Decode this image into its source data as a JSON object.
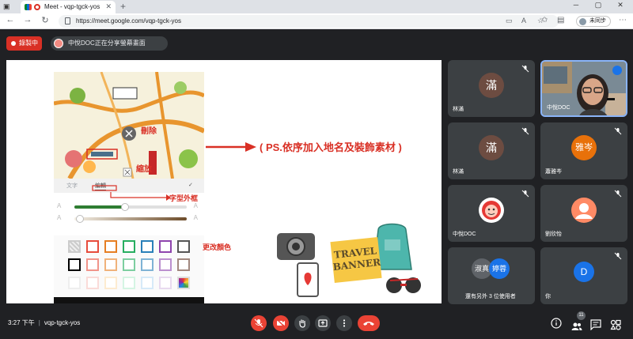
{
  "browser": {
    "tab_title": "Meet - vqp-tgck-yos",
    "tab_close": "✕",
    "new_tab": "+",
    "url": "https://meet.google.com/vqp-tgck-yos",
    "sync_label": "未同步",
    "window_minimize": "─",
    "window_maximize": "▢",
    "window_close": "✕"
  },
  "meet_top": {
    "recording_label": "錄製中",
    "presenter_text": "中悅DOC正在分享螢幕畫面"
  },
  "shared_screen": {
    "annotations": {
      "delete": "刪除",
      "scale": "縮放",
      "font_frame": "字型外框",
      "change_color": "更改顏色",
      "ps_note": "( PS.依序加入地名及裝飾素材 )"
    },
    "edit_tabs": [
      "文字",
      "編輯"
    ],
    "slider_levels": {
      "green": 0.45,
      "brown": 0.05
    },
    "swatch_colors": [
      [
        "#cccccc",
        "#e74c3c",
        "#e67e22",
        "#27ae60",
        "#2980b9",
        "#8e44ad",
        "#555555"
      ],
      [
        "#000000",
        "#f1948a",
        "#f0b27a",
        "#7dcea0",
        "#7fb3d5",
        "#bb8fce",
        "#a1887f"
      ],
      [
        "#eeeeee",
        "#fadbd8",
        "#fdebd0",
        "#d5f5e3",
        "#d6eaf8",
        "#e8daef",
        "#rainbow"
      ]
    ],
    "travel_banner": "TRAVEL BANNER"
  },
  "participants": [
    {
      "name": "林滿",
      "initial": "滿",
      "avatar_color": "#6d4c41",
      "muted": true
    },
    {
      "name": "中悅DOC",
      "initial": "",
      "avatar_color": "",
      "muted": false,
      "camera": true
    },
    {
      "name": "林滿",
      "initial": "滿",
      "avatar_color": "#6d4c41",
      "muted": true
    },
    {
      "name": "蕭雅岑",
      "initial": "雅岑",
      "avatar_color": "#e8710a",
      "muted": true
    },
    {
      "name": "中悅DOC",
      "initial": "",
      "avatar_color": "#ffffff",
      "muted": true
    },
    {
      "name": "劉欣怡",
      "initial": "",
      "avatar_color": "#ff8a65",
      "muted": true
    },
    {
      "name": "還有另外 3 位使用者",
      "initial": "淑真",
      "initial2": "婷蓉",
      "avatar_color": "#5f6368",
      "avatar_color2": "#1a73e8",
      "muted": false
    },
    {
      "name": "你",
      "initial": "D",
      "avatar_color": "#1a73e8",
      "muted": true
    }
  ],
  "bottom": {
    "time": "3:27 下午",
    "separator": "|",
    "meeting_code": "vqp-tgck-yos",
    "people_count": "11"
  },
  "colors": {
    "accent_red": "#ea4335",
    "meet_bg": "#202124",
    "tile_bg": "#3c4043"
  }
}
